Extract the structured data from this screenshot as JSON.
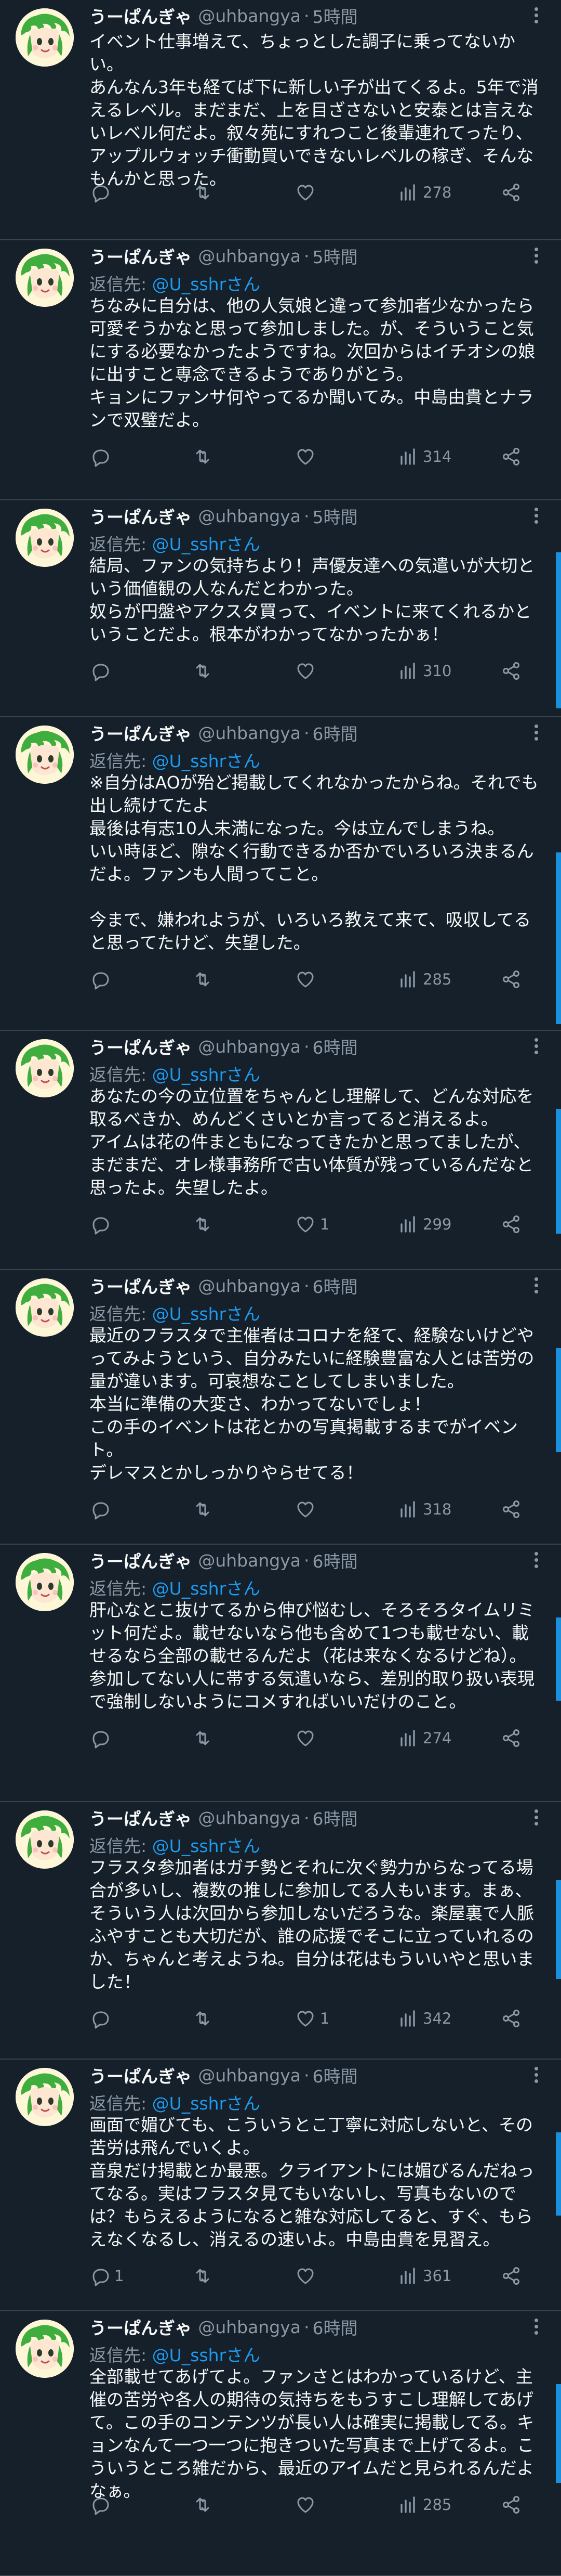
{
  "user": {
    "display_name": "うーぱんぎゃ",
    "handle": "@uhbangya"
  },
  "reply_label": "返信先: ",
  "tweets": [
    {
      "time": "5時間",
      "reply_to": "",
      "text": "イベント仕事増えて、ちょっとした調子に乗ってないかい。\nあんなん3年も経てば下に新しい子が出てくるよ。5年で消えるレベル。まだまだ、上を目ざさないと安泰とは言えないレベル何だよ。叙々苑にすれつこと後輩連れてったり、アップルウォッチ衝動買いできないレベルの稼ぎ、そんなもんかと思った。",
      "replies": "",
      "retweets": "",
      "likes": "",
      "views": "278"
    },
    {
      "time": "5時間",
      "reply_to": "@U_sshrさん",
      "text": "ちなみに自分は、他の人気娘と違って参加者少なかったら可愛そうかなと思って参加しました。が、そういうこと気にする必要なかったようですね。次回からはイチオシの娘に出すこと専念できるようでありがとう。\nキョンにファンサ何やってるか聞いてみ。中島由貴とナランで双璧だよ。",
      "replies": "",
      "retweets": "",
      "likes": "",
      "views": "314"
    },
    {
      "time": "5時間",
      "reply_to": "@U_sshrさん",
      "text": "結局、ファンの気持ちより！声優友達への気遣いが大切という価値観の人なんだとわかった。\n奴らが円盤やアクスタ買って、イベントに来てくれるかということだよ。根本がわかってなかったかぁ！",
      "replies": "",
      "retweets": "",
      "likes": "",
      "views": "310"
    },
    {
      "time": "6時間",
      "reply_to": "@U_sshrさん",
      "text": "※自分はAOが殆ど掲載してくれなかったからね。それでも出し続けてたよ\n最後は有志10人未満になった。今は立んでしまうね。\nいい時ほど、隙なく行動できるか否かでいろいろ決まるんだよ。ファンも人間ってこと。\n\n今まで、嫌われようが、いろいろ教えて来て、吸収してると思ってたけど、失望した。",
      "replies": "",
      "retweets": "",
      "likes": "",
      "views": "285"
    },
    {
      "time": "6時間",
      "reply_to": "@U_sshrさん",
      "text": "あなたの今の立位置をちゃんとし理解して、どんな対応を取るべきか、めんどくさいとか言ってると消えるよ。\nアイムは花の件まともになってきたかと思ってましたが、まだまだ、オレ様事務所で古い体質が残っているんだなと思ったよ。失望したよ。",
      "replies": "",
      "retweets": "",
      "likes": "1",
      "views": "299"
    },
    {
      "time": "6時間",
      "reply_to": "@U_sshrさん",
      "text": "最近のフラスタで主催者はコロナを経て、経験ないけどやってみようという、自分みたいに経験豊富な人とは苦労の量が違います。可哀想なことしてしまいました。\n本当に準備の大変さ、わかってないでしょ！\nこの手のイベントは花とかの写真掲載するまでがイベント。\nデレマスとかしっかりやらせてる！",
      "replies": "",
      "retweets": "",
      "likes": "",
      "views": "318"
    },
    {
      "time": "6時間",
      "reply_to": "@U_sshrさん",
      "text": "肝心なとこ抜けてるから伸び悩むし、そろそろタイムリミット何だよ。載せないなら他も含めて1つも載せない、載せるなら全部の載せるんだよ（花は来なくなるけどね）。\n参加してない人に帯する気遣いなら、差別的取り扱い表現で強制しないようにコメすればいいだけのこと。",
      "replies": "",
      "retweets": "",
      "likes": "",
      "views": "274"
    },
    {
      "time": "6時間",
      "reply_to": "@U_sshrさん",
      "text": "フラスタ参加者はガチ勢とそれに次ぐ勢力からなってる場合が多いし、複数の推しに参加してる人もいます。まぁ、そういう人は次回から参加しないだろうな。楽屋裏で人脈ふやすことも大切だが、誰の応援でそこに立っていれるのか、ちゃんと考えようね。自分は花はもういいやと思いました！",
      "replies": "",
      "retweets": "",
      "likes": "1",
      "views": "342"
    },
    {
      "time": "6時間",
      "reply_to": "@U_sshrさん",
      "text": "画面で媚びても、こういうとこ丁寧に対応しないと、その苦労は飛んでいくよ。\n音泉だけ掲載とか最悪。クライアントには媚びるんだねってなる。実はフラスタ見てもいないし、写真もないのでは？もらえるようになると雑な対応してると、すぐ、もらえなくなるし、消えるの速いよ。中島由貴を見習え。",
      "replies": "1",
      "retweets": "",
      "likes": "",
      "views": "361"
    },
    {
      "time": "6時間",
      "reply_to": "@U_sshrさん",
      "text": "全部載せてあげてよ。ファンさとはわかっているけど、主催の苦労や各人の期待の気持ちをもうすこし理解してあげて。この手のコンテンツが長い人は確実に掲載してる。キョンなんて一つ一つに抱きついた写真まで上げてるよ。こういうところ雑だから、最近のアイムだと見られるんだよなぁ。",
      "replies": "",
      "retweets": "",
      "likes": "",
      "views": "285"
    }
  ],
  "icons": {
    "reply": "reply-icon",
    "retweet": "retweet-icon",
    "like": "like-icon",
    "views": "views-icon",
    "share": "share-icon",
    "more": "more-icon"
  },
  "colors": {
    "background": "#15202b",
    "text": "#f7f9f9",
    "secondary": "#8b98a5",
    "accent": "#1d9bf0",
    "divider": "#38444d"
  }
}
